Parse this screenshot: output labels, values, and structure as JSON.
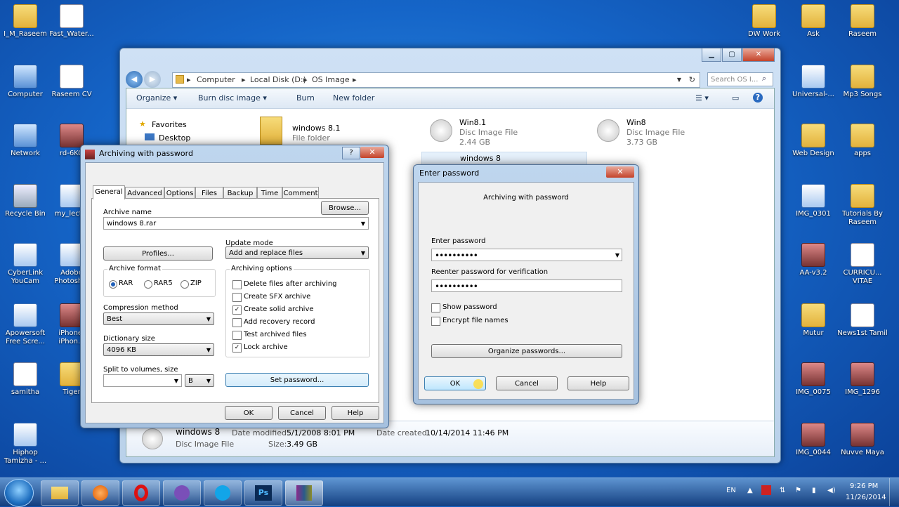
{
  "desktop_left": [
    {
      "label": "I_M_Raseem",
      "icon": "folder"
    },
    {
      "label": "Fast_Water...",
      "icon": "doc"
    },
    {
      "label": "Computer",
      "icon": "pc"
    },
    {
      "label": "Raseem CV",
      "icon": "doc"
    },
    {
      "label": "Network",
      "icon": "pc"
    },
    {
      "label": "rd-6KO",
      "icon": "img"
    },
    {
      "label": "Recycle Bin",
      "icon": "bin"
    },
    {
      "label": "my_lect...",
      "icon": "app"
    },
    {
      "label": "CyberLink YouCam",
      "icon": "app"
    },
    {
      "label": "Adobe Photosh...",
      "icon": "app"
    },
    {
      "label": "Apowersoft Free Scre...",
      "icon": "app"
    },
    {
      "label": "iPhone-iPhon...",
      "icon": "img"
    },
    {
      "label": "samitha",
      "icon": "doc"
    },
    {
      "label": "Tiger",
      "icon": "folder"
    },
    {
      "label": "Hiphop Tamizha - ...",
      "icon": "app"
    }
  ],
  "desktop_right": [
    {
      "label": "DW Work",
      "icon": "folder"
    },
    {
      "label": "Ask",
      "icon": "folder"
    },
    {
      "label": "Raseem",
      "icon": "folder"
    },
    {
      "label": "Universal-...",
      "icon": "app"
    },
    {
      "label": "Mp3 Songs",
      "icon": "folder"
    },
    {
      "label": "Web Design",
      "icon": "folder"
    },
    {
      "label": "apps",
      "icon": "folder"
    },
    {
      "label": "IMG_0301",
      "icon": "app"
    },
    {
      "label": "Tutorials By Raseem",
      "icon": "folder"
    },
    {
      "label": "AA-v3.2",
      "icon": "img"
    },
    {
      "label": "CURRICU... VITAE",
      "icon": "doc"
    },
    {
      "label": "Mutur",
      "icon": "folder"
    },
    {
      "label": "News1st Tamil",
      "icon": "doc"
    },
    {
      "label": "IMG_0075",
      "icon": "img"
    },
    {
      "label": "IMG_1296",
      "icon": "img"
    },
    {
      "label": "IMG_0044",
      "icon": "img"
    },
    {
      "label": "Nuvve Maya",
      "icon": "img"
    }
  ],
  "explorer": {
    "breadcrumb": [
      "Computer",
      "Local Disk (D:)",
      "OS Image"
    ],
    "search_placeholder": "Search OS I...",
    "toolbar": {
      "organize": "Organize ▾",
      "burn": "Burn disc image ▾",
      "burn_short": "Burn",
      "new_folder": "New folder"
    },
    "nav": {
      "favorites": "Favorites",
      "desktop": "Desktop"
    },
    "files": [
      {
        "name": "windows 8.1",
        "type": "File folder",
        "size": ""
      },
      {
        "name": "Win8.1",
        "type": "Disc Image File",
        "size": "2.44 GB"
      },
      {
        "name": "Win8",
        "type": "Disc Image File",
        "size": "3.73 GB"
      },
      {
        "name": "windows 8",
        "type": "",
        "size": ""
      }
    ],
    "details": {
      "name": "windows 8",
      "type": "Disc Image File",
      "modified_label": "Date modified:",
      "modified": "5/1/2008 8:01 PM",
      "size_label": "Size:",
      "size": "3.49 GB",
      "created_label": "Date created:",
      "created": "10/14/2014 11:46 PM"
    }
  },
  "archive_dialog": {
    "title": "Archiving with password",
    "tabs": [
      "General",
      "Advanced",
      "Options",
      "Files",
      "Backup",
      "Time",
      "Comment"
    ],
    "archive_name_label": "Archive name",
    "archive_name": "windows 8.rar",
    "browse": "Browse...",
    "update_mode_label": "Update mode",
    "update_mode": "Add and replace files",
    "profiles": "Profiles...",
    "archive_format_label": "Archive format",
    "formats": [
      "RAR",
      "RAR5",
      "ZIP"
    ],
    "archiving_options_label": "Archiving options",
    "options": [
      {
        "label": "Delete files after archiving",
        "checked": false
      },
      {
        "label": "Create SFX archive",
        "checked": false
      },
      {
        "label": "Create solid archive",
        "checked": true
      },
      {
        "label": "Add recovery record",
        "checked": false
      },
      {
        "label": "Test archived files",
        "checked": false
      },
      {
        "label": "Lock archive",
        "checked": true
      }
    ],
    "compression_label": "Compression method",
    "compression": "Best",
    "dictionary_label": "Dictionary size",
    "dictionary": "4096 KB",
    "split_label": "Split to volumes, size",
    "split_value": "",
    "split_unit": "B",
    "set_password": "Set password...",
    "ok": "OK",
    "cancel": "Cancel",
    "help": "Help"
  },
  "password_dialog": {
    "title": "Enter password",
    "subtitle": "Archiving with password",
    "enter_label": "Enter password",
    "enter_value": "••••••••••",
    "reenter_label": "Reenter password for verification",
    "reenter_value": "••••••••••",
    "show_password": "Show password",
    "encrypt_names": "Encrypt file names",
    "organize": "Organize passwords...",
    "ok": "OK",
    "cancel": "Cancel",
    "help": "Help"
  },
  "taskbar": {
    "apps": [
      "explorer-icon",
      "media-player-icon",
      "opera-icon",
      "viber-icon",
      "skype-icon",
      "photoshop-icon",
      "winrar-icon"
    ],
    "ps_label": "Ps",
    "lang": "EN",
    "time": "9:26 PM",
    "date": "11/26/2014"
  }
}
